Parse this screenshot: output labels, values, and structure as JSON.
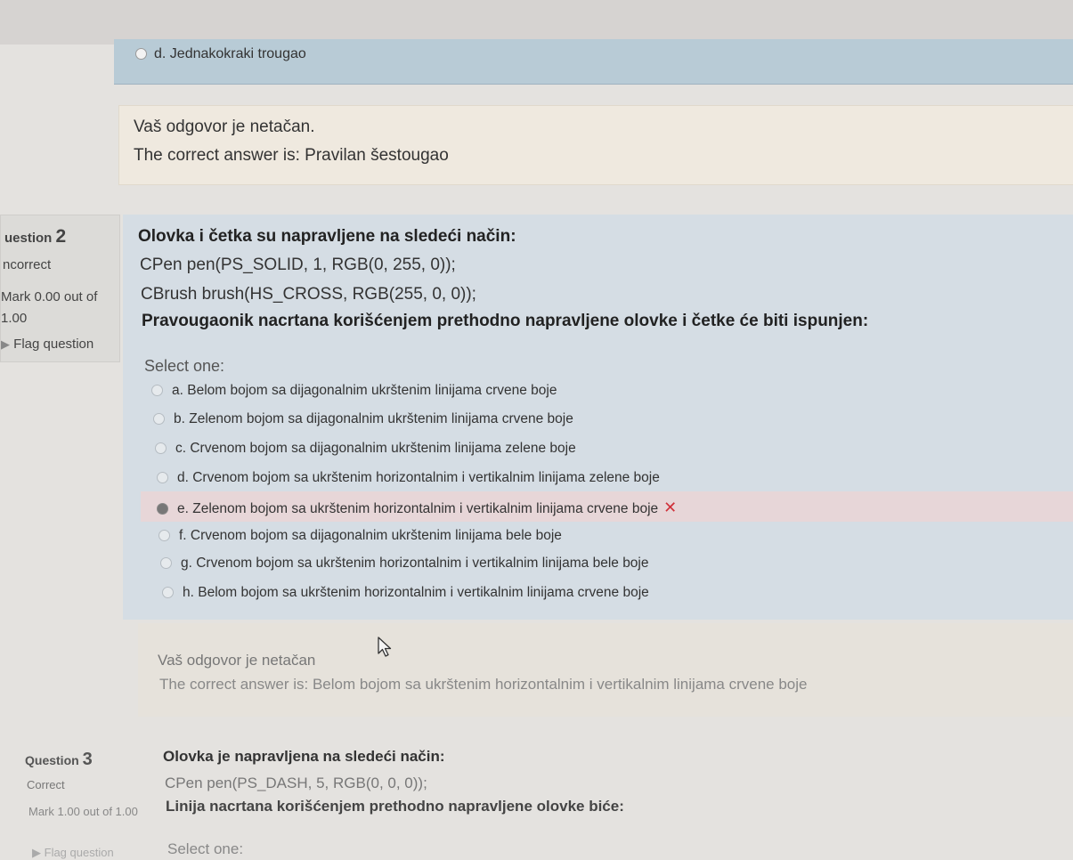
{
  "previous_question": {
    "last_option": "d. Jednakokraki trougao",
    "feedback": "Vaš odgovor je netačan.",
    "correct_answer": "The correct answer is: Pravilan šestougao"
  },
  "q2": {
    "number_label": "uestion",
    "number": "2",
    "state": "ncorrect",
    "grade": "Mark 0.00 out of 1.00",
    "flag_label": "Flag question",
    "title": "Olovka i četka su napravljene na sledeći način:",
    "code_line_1": "CPen pen(PS_SOLID, 1, RGB(0, 255, 0));",
    "code_line_2": "CBrush brush(HS_CROSS, RGB(255, 0, 0));",
    "prompt": "Pravougaonik nacrtana korišćenjem prethodno napravljene olovke i četke će biti ispunjen:",
    "select_label": "Select one:",
    "options": [
      "a. Belom bojom sa dijagonalnim ukrštenim linijama crvene boje",
      "b. Zelenom bojom sa dijagonalnim ukrštenim linijama crvene boje",
      "c. Crvenom bojom sa dijagonalnim ukrštenim linijama zelene boje",
      "d. Crvenom bojom sa ukrštenim horizontalnim i vertikalnim linijama zelene boje",
      "e. Zelenom bojom sa ukrštenim horizontalnim i vertikalnim linijama crvene boje",
      "f. Crvenom bojom sa dijagonalnim ukrštenim linijama bele boje",
      "g. Crvenom bojom sa ukrštenim horizontalnim i vertikalnim linijama bele boje",
      "h. Belom bojom sa ukrštenim horizontalnim i vertikalnim linijama crvene boje"
    ],
    "selected_option_index": 4,
    "wrong_mark": "✕",
    "feedback": "Vaš odgovor je netačan",
    "correct_answer": "The correct answer is: Belom bojom sa ukrštenim horizontalnim i vertikalnim linijama crvene boje"
  },
  "q3": {
    "number_label": "Question",
    "number": "3",
    "state": "Correct",
    "grade": "Mark 1.00 out of 1.00",
    "flag_label": "Flag question",
    "title": "Olovka je napravljena na sledeći način:",
    "code_line_1": "CPen pen(PS_DASH, 5, RGB(0, 0, 0));",
    "prompt": "Linija nacrtana korišćenjem prethodno napravljene olovke biće:",
    "select_label": "Select one:"
  },
  "colors": {
    "wrong_mark": "#d0313a",
    "question_bg": "#d5dde4",
    "feedback_bg": "#efe9df",
    "incorrect_highlight": "#e7d6d8"
  }
}
